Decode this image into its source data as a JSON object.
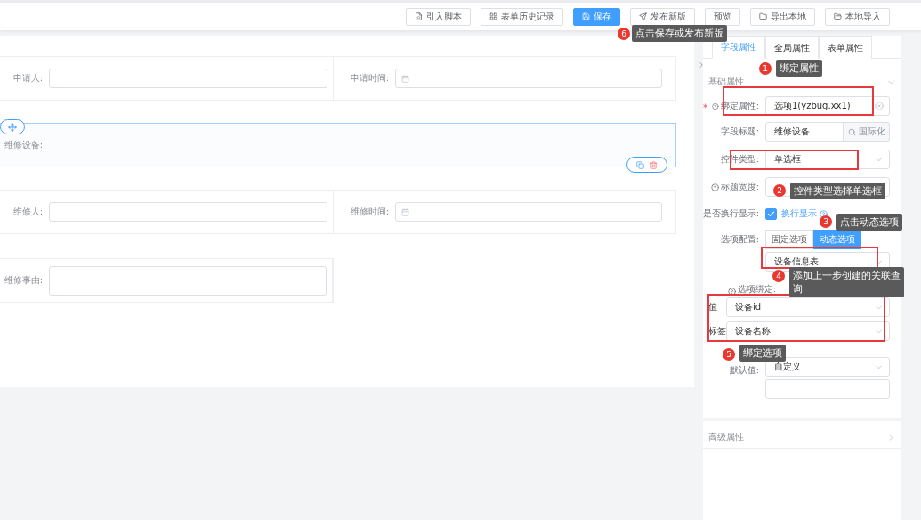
{
  "toolbar": {
    "buttons": [
      {
        "label": "引入脚本",
        "kind": "script",
        "primary": false
      },
      {
        "label": "表单历史记录",
        "kind": "history",
        "primary": false
      },
      {
        "label": "保存",
        "kind": "save",
        "primary": true
      },
      {
        "label": "发布新版",
        "kind": "publish",
        "primary": false
      },
      {
        "label": "预览",
        "kind": "plain",
        "primary": false
      },
      {
        "label": "导出本地",
        "kind": "export",
        "primary": false
      },
      {
        "label": "本地导入",
        "kind": "import",
        "primary": false
      }
    ]
  },
  "form": {
    "rows": [
      {
        "selected": false,
        "fields": [
          {
            "label": "申请人:",
            "kind": "text"
          },
          {
            "label": "申请时间:",
            "kind": "date"
          }
        ]
      },
      {
        "selected": true,
        "fields": [
          {
            "label": "维修设备:",
            "kind": "radio"
          }
        ]
      },
      {
        "selected": false,
        "fields": [
          {
            "label": "维修人:",
            "kind": "text"
          },
          {
            "label": "维修时间:",
            "kind": "date"
          }
        ]
      },
      {
        "selected": false,
        "fields": [
          {
            "label": "维修事由:",
            "kind": "textarea"
          }
        ]
      }
    ]
  },
  "panel": {
    "tabs": [
      {
        "label": "字段属性",
        "selected": true
      },
      {
        "label": "全局属性",
        "selected": false
      },
      {
        "label": "表单属性",
        "selected": false
      }
    ],
    "basic_section": {
      "title": "基础属性",
      "expanded": true
    },
    "properties": [
      {
        "kind": "input",
        "label": "绑定属性:",
        "required": true,
        "help": true,
        "value": "选项1(yzbug.xx1)",
        "clearable": true
      },
      {
        "kind": "input-button",
        "label": "字段标题:",
        "value": "维修设备",
        "button": "国际化"
      },
      {
        "kind": "select",
        "label": "控件类型:",
        "value": "单选框"
      },
      {
        "kind": "input",
        "label": "标题宽度:",
        "help": true
      },
      {
        "kind": "checkbox",
        "label": "是否换行显示:",
        "checked": true,
        "text": "换行显示",
        "help": true
      },
      {
        "kind": "segmented",
        "label": "选项配置:",
        "options": [
          {
            "label": "固定选项",
            "selected": false
          },
          {
            "label": "动态选项",
            "selected": true
          }
        ]
      },
      {
        "kind": "select",
        "value": "设备信息表"
      },
      {
        "kind": "heading",
        "label": "选项绑定:",
        "help": true
      },
      {
        "kind": "inline-select",
        "label": "值",
        "value": "设备id"
      },
      {
        "kind": "inline-select",
        "label": "标签",
        "value": "设备名称"
      },
      {
        "kind": "select",
        "label": "默认值:",
        "value": "自定义"
      },
      {
        "kind": "input"
      }
    ],
    "advanced_section": {
      "title": "高级属性",
      "expanded": false
    }
  },
  "annotations": [
    {
      "number": "6",
      "text": "点击保存或发布新版"
    },
    {
      "number": "1",
      "text": "绑定属性"
    },
    {
      "number": "2",
      "text": "控件类型选择单选框"
    },
    {
      "number": "3",
      "text": "点击动态选项"
    },
    {
      "number": "4",
      "text": "添加上一步创建的关联查询"
    },
    {
      "number": "5",
      "text": "绑定选项"
    }
  ]
}
